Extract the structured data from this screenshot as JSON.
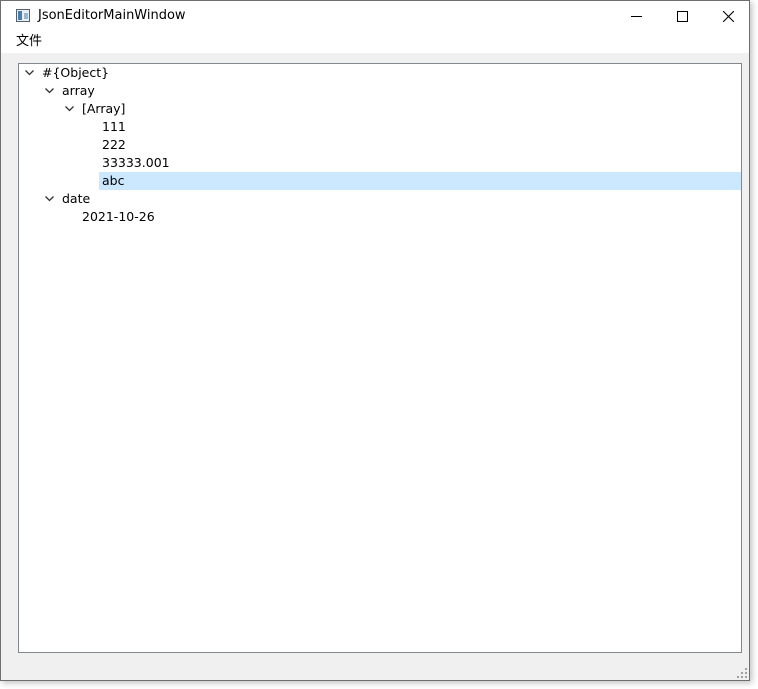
{
  "window": {
    "title": "JsonEditorMainWindow"
  },
  "menu": {
    "items": [
      {
        "label": "文件"
      }
    ]
  },
  "tree": {
    "nodes": [
      {
        "label": "#{Object}",
        "depth": 0,
        "expanded": true,
        "has_children": true,
        "selected": false
      },
      {
        "label": "array",
        "depth": 1,
        "expanded": true,
        "has_children": true,
        "selected": false
      },
      {
        "label": "[Array]",
        "depth": 2,
        "expanded": true,
        "has_children": true,
        "selected": false
      },
      {
        "label": "111",
        "depth": 3,
        "expanded": false,
        "has_children": false,
        "selected": false
      },
      {
        "label": "222",
        "depth": 3,
        "expanded": false,
        "has_children": false,
        "selected": false
      },
      {
        "label": "33333.001",
        "depth": 3,
        "expanded": false,
        "has_children": false,
        "selected": false
      },
      {
        "label": "abc",
        "depth": 3,
        "expanded": false,
        "has_children": false,
        "selected": true
      },
      {
        "label": "date",
        "depth": 1,
        "expanded": true,
        "has_children": true,
        "selected": false
      },
      {
        "label": "2021-10-26",
        "depth": 2,
        "expanded": false,
        "has_children": false,
        "selected": false
      }
    ]
  },
  "colors": {
    "selection": "#cce8ff",
    "border": "#828790"
  }
}
